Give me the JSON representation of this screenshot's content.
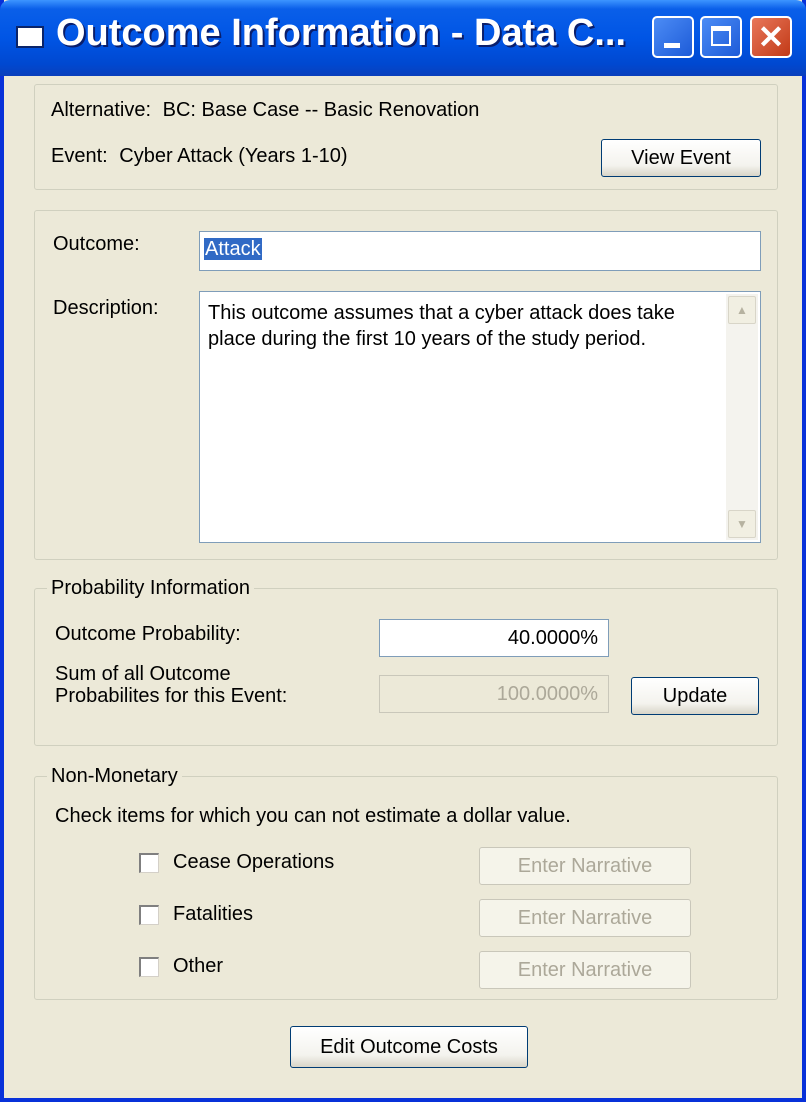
{
  "window": {
    "title": "Outcome Information - Data C..."
  },
  "context": {
    "alternative_label": "Alternative:",
    "alternative_value": "BC: Base Case -- Basic Renovation",
    "event_label": "Event:",
    "event_value": "Cyber Attack (Years 1-10)",
    "view_event_button": "View Event"
  },
  "outcome": {
    "outcome_label": "Outcome:",
    "outcome_value": "Attack",
    "description_label": "Description:",
    "description_value": "This outcome assumes that a cyber attack does take place during the first 10 years of the study period.",
    "scroll_up_icon": "up-arrow-icon",
    "scroll_down_icon": "down-arrow-icon"
  },
  "probability": {
    "legend": "Probability Information",
    "outcome_probability_label": "Outcome Probability:",
    "outcome_probability_value": "40.0000%",
    "sum_label_line1": "Sum of all Outcome",
    "sum_label_line2": "Probabilites for this Event:",
    "sum_value": "100.0000%",
    "update_button": "Update"
  },
  "non_monetary": {
    "legend": "Non-Monetary",
    "instructions": "Check items for which you can not estimate a dollar value.",
    "items": [
      {
        "label": "Cease Operations",
        "checked": false,
        "button": "Enter Narrative"
      },
      {
        "label": "Fatalities",
        "checked": false,
        "button": "Enter Narrative"
      },
      {
        "label": "Other",
        "checked": false,
        "button": "Enter Narrative"
      }
    ]
  },
  "footer": {
    "edit_costs_button": "Edit Outcome Costs"
  },
  "colors": {
    "titlebar": "#0055E5",
    "window_face": "#ECE9D8",
    "selection": "#316AC5"
  }
}
